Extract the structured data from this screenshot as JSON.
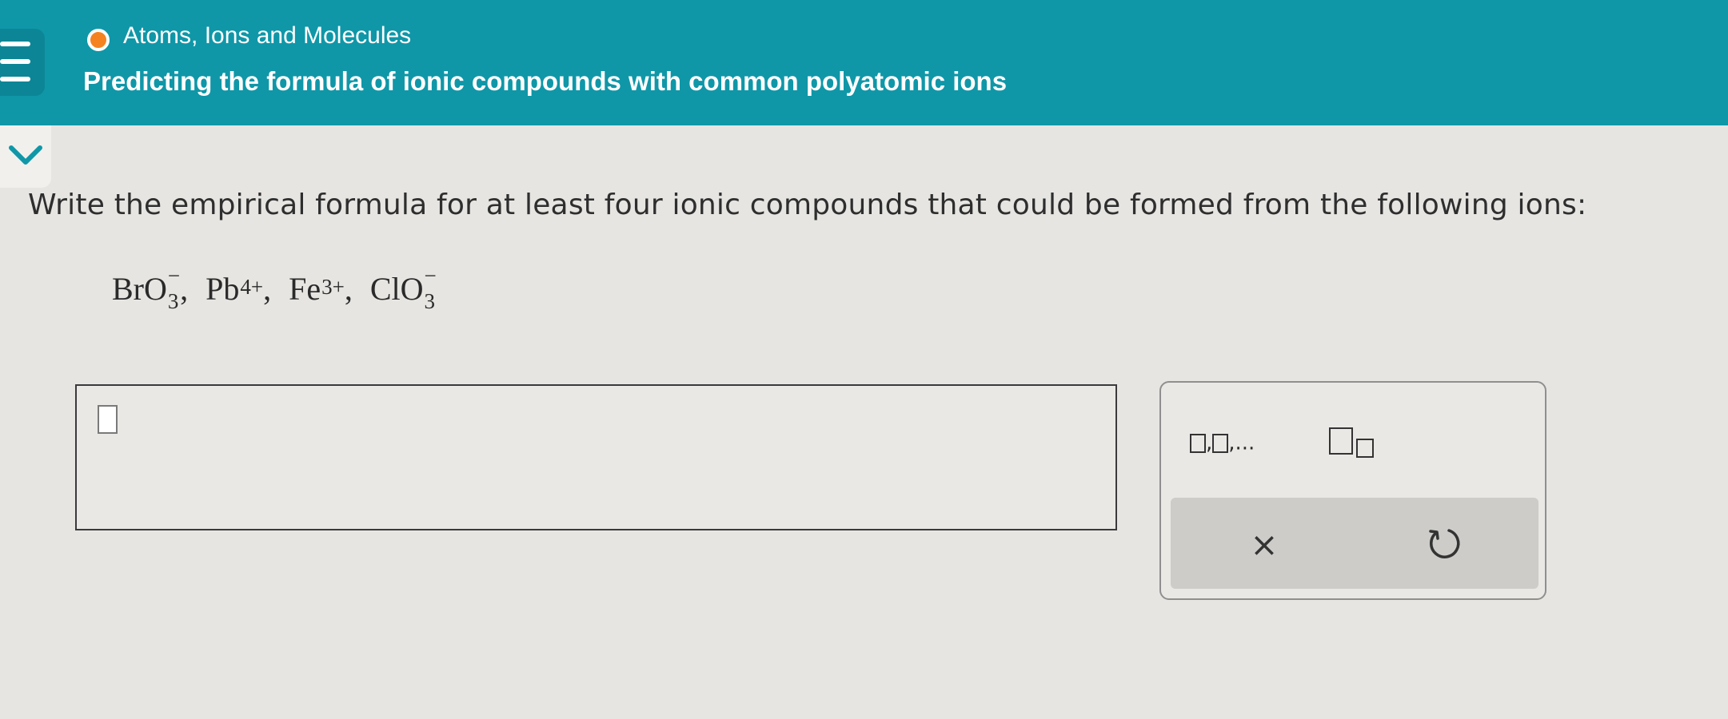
{
  "header": {
    "topic": "Atoms, Ions and Molecules",
    "title": "Predicting the formula of ionic compounds with common polyatomic ions",
    "colors": {
      "bar": "#0f97a8",
      "topic_dot": "#f58220"
    }
  },
  "question": {
    "prompt": "Write the empirical formula for at least four ionic compounds that could be formed from the following ions:",
    "ions": [
      {
        "base": "BrO",
        "sub": "3",
        "sup": "−",
        "sep": ","
      },
      {
        "base": "Pb",
        "sub": "",
        "sup": "4+",
        "sep": ","
      },
      {
        "base": "Fe",
        "sub": "",
        "sup": "3+",
        "sep": ","
      },
      {
        "base": "ClO",
        "sub": "3",
        "sup": "−",
        "sep": ""
      }
    ]
  },
  "tools": {
    "list_template": ",,...",
    "subscript_template_icon": "subscript-template-icon",
    "clear_symbol": "×",
    "undo_icon": "undo-icon"
  }
}
